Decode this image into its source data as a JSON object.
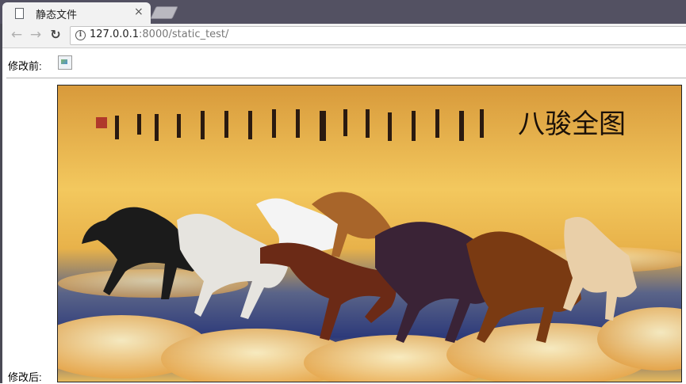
{
  "browser": {
    "tab_title": "静态文件",
    "tab_close": "×",
    "url_host": "127.0.0.1",
    "url_rest": ":8000/static_test/",
    "back_icon": "back-arrow-icon",
    "forward_icon": "forward-arrow-icon",
    "reload_icon": "reload-icon",
    "info_icon": "info-icon"
  },
  "page": {
    "label_before": "修改前:",
    "label_after": "修改后:",
    "painting_title": "八骏全图"
  },
  "colors": {
    "tab_strip": "#535162",
    "toolbar": "#f2f2f2",
    "sky_top": "#e9a43a",
    "sky_mid": "#f6d06a"
  }
}
